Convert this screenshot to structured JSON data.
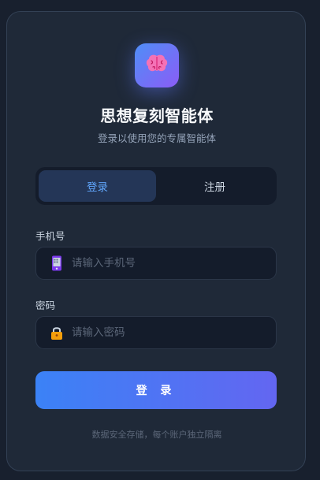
{
  "app": {
    "title": "思想复刻智能体",
    "subtitle": "登录以使用您的专属智能体",
    "logo_icon": "brain-icon"
  },
  "tabs": [
    {
      "label": "登录",
      "active": true
    },
    {
      "label": "注册",
      "active": false
    }
  ],
  "form": {
    "phone": {
      "label": "手机号",
      "placeholder": "请输入手机号",
      "value": "",
      "icon": "mobile-phone-icon"
    },
    "password": {
      "label": "密码",
      "placeholder": "请输入密码",
      "value": "",
      "icon": "lock-icon"
    },
    "submit_label": "登 录"
  },
  "footer": {
    "note": "数据安全存储，每个账户独立隔离"
  },
  "colors": {
    "accent": "#60a5fa",
    "button_gradient_start": "#3b82f6",
    "button_gradient_end": "#6366f1",
    "card_bg": "#1f2938"
  }
}
